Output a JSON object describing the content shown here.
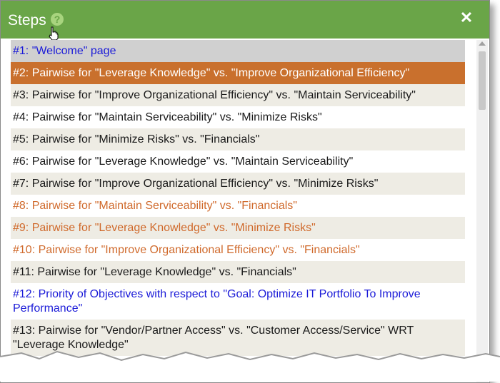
{
  "dialog": {
    "title": "Steps",
    "help_icon": "question-circle-icon",
    "close_icon": "close-x-icon",
    "colors": {
      "header": "#6aa548",
      "current_row": "#c9702d",
      "orange_text": "#d06a2c",
      "blue_text": "#1b1bd8",
      "visited_row": "#d0d0d0",
      "alt_row": "#eeece4"
    }
  },
  "steps": [
    {
      "label": "#1: \"Welcome\" page",
      "state": "visited"
    },
    {
      "label": "#2: Pairwise for \"Leverage Knowledge\" vs. \"Improve Organizational Efficiency\"",
      "state": "current"
    },
    {
      "label": "#3: Pairwise for \"Improve Organizational Efficiency\" vs. \"Maintain Serviceability\"",
      "state": "normal"
    },
    {
      "label": "#4: Pairwise for \"Maintain Serviceability\" vs. \"Minimize Risks\"",
      "state": "normal"
    },
    {
      "label": "#5: Pairwise for \"Minimize Risks\" vs. \"Financials\"",
      "state": "normal"
    },
    {
      "label": "#6: Pairwise for \"Leverage Knowledge\" vs. \"Maintain Serviceability\"",
      "state": "normal"
    },
    {
      "label": "#7: Pairwise for \"Improve Organizational Efficiency\" vs. \"Minimize Risks\"",
      "state": "normal"
    },
    {
      "label": "#8: Pairwise for \"Maintain Serviceability\" vs. \"Financials\"",
      "state": "orange"
    },
    {
      "label": "#9: Pairwise for \"Leverage Knowledge\" vs. \"Minimize Risks\"",
      "state": "orange"
    },
    {
      "label": "#10: Pairwise for \"Improve Organizational Efficiency\" vs. \"Financials\"",
      "state": "orange"
    },
    {
      "label": "#11: Pairwise for \"Leverage Knowledge\" vs. \"Financials\"",
      "state": "normal"
    },
    {
      "label": "#12: Priority of Objectives with respect to \"Goal: Optimize IT Portfolio To Improve Performance\"",
      "state": "blue"
    },
    {
      "label": "#13: Pairwise for \"Vendor/Partner Access\" vs. \"Customer Access/Service\" WRT \"Leverage Knowledge\"",
      "state": "normal"
    }
  ]
}
